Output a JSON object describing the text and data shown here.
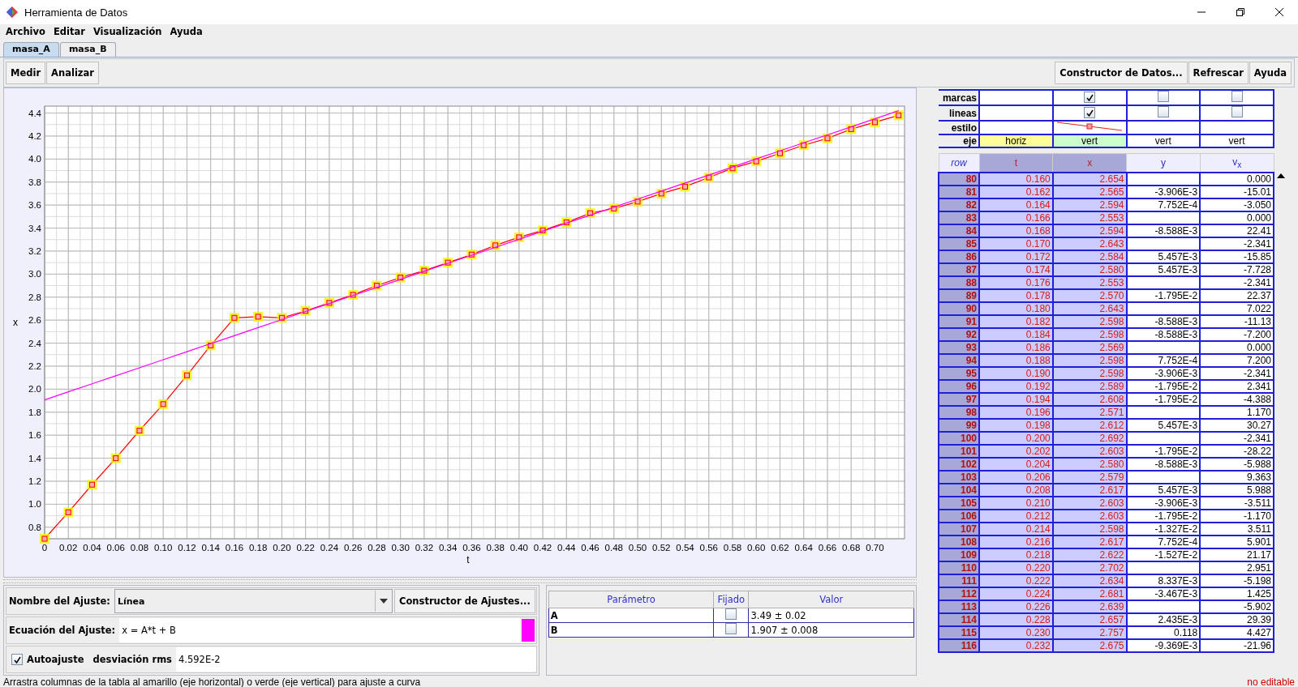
{
  "window": {
    "title": "Herramienta de Datos"
  },
  "menu": [
    "Archivo",
    "Editar",
    "Visualización",
    "Ayuda"
  ],
  "tabs": [
    {
      "label": "masa_A",
      "selected": true
    },
    {
      "label": "masa_B",
      "selected": false
    }
  ],
  "toolbar": {
    "left": [
      "Medir",
      "Analizar"
    ],
    "right": [
      "Constructor de Datos...",
      "Refrescar",
      "Ayuda"
    ]
  },
  "chart": {
    "chart_data": {
      "type": "line",
      "grid": true,
      "xlabel": "t",
      "ylabel": "x",
      "xlim": [
        0,
        0.725
      ],
      "ylim": [
        0.7,
        4.46
      ],
      "x": [
        0,
        0.02,
        0.04,
        0.06,
        0.08,
        0.1,
        0.12,
        0.14,
        0.16,
        0.18,
        0.2,
        0.22,
        0.24,
        0.26,
        0.28,
        0.3,
        0.32,
        0.34,
        0.36,
        0.38,
        0.4,
        0.42,
        0.44,
        0.46,
        0.48,
        0.5,
        0.52,
        0.54,
        0.56,
        0.58,
        0.6,
        0.62,
        0.64,
        0.66,
        0.68,
        0.7,
        0.72
      ],
      "series": [
        {
          "color": "#ff0000",
          "marker": "square",
          "values": [
            0.7,
            0.93,
            1.17,
            1.4,
            1.64,
            1.87,
            2.12,
            2.38,
            2.62,
            2.63,
            2.62,
            2.68,
            2.75,
            2.82,
            2.9,
            2.97,
            3.03,
            3.1,
            3.17,
            3.25,
            3.32,
            3.38,
            3.45,
            3.53,
            3.57,
            3.63,
            3.7,
            3.76,
            3.84,
            3.92,
            3.98,
            4.05,
            4.12,
            4.18,
            4.26,
            4.32,
            4.38
          ]
        },
        {
          "color": "#ff00ff",
          "values": [
            1.907,
            1.977,
            2.047,
            2.116,
            2.186,
            2.256,
            2.326,
            2.396,
            2.465,
            2.535,
            2.605,
            2.675,
            2.745,
            2.814,
            2.884,
            2.954,
            3.024,
            3.094,
            3.163,
            3.233,
            3.303,
            3.373,
            3.443,
            3.512,
            3.582,
            3.652,
            3.722,
            3.792,
            3.861,
            3.931,
            4.001,
            4.071,
            4.141,
            4.21,
            4.28,
            4.35,
            4.42
          ]
        }
      ],
      "xticks": [
        {
          "value": 0,
          "label": "0"
        },
        {
          "value": 0.02,
          "label": "0.02"
        },
        {
          "value": 0.04,
          "label": "0.04"
        },
        {
          "value": 0.06,
          "label": "0.06"
        },
        {
          "value": 0.08,
          "label": "0.08"
        },
        {
          "value": 0.1,
          "label": "0.10"
        },
        {
          "value": 0.12,
          "label": "0.12"
        },
        {
          "value": 0.14,
          "label": "0.14"
        },
        {
          "value": 0.16,
          "label": "0.16"
        },
        {
          "value": 0.18,
          "label": "0.18"
        },
        {
          "value": 0.2,
          "label": "0.20"
        },
        {
          "value": 0.22,
          "label": "0.22"
        },
        {
          "value": 0.24,
          "label": "0.24"
        },
        {
          "value": 0.26,
          "label": "0.26"
        },
        {
          "value": 0.28,
          "label": "0.28"
        },
        {
          "value": 0.3,
          "label": "0.30"
        },
        {
          "value": 0.32,
          "label": "0.32"
        },
        {
          "value": 0.34,
          "label": "0.34"
        },
        {
          "value": 0.36,
          "label": "0.36"
        },
        {
          "value": 0.38,
          "label": "0.38"
        },
        {
          "value": 0.4,
          "label": "0.40"
        },
        {
          "value": 0.42,
          "label": "0.42"
        },
        {
          "value": 0.44,
          "label": "0.44"
        },
        {
          "value": 0.46,
          "label": "0.46"
        },
        {
          "value": 0.48,
          "label": "0.48"
        },
        {
          "value": 0.5,
          "label": "0.50"
        },
        {
          "value": 0.52,
          "label": "0.52"
        },
        {
          "value": 0.54,
          "label": "0.54"
        },
        {
          "value": 0.56,
          "label": "0.56"
        },
        {
          "value": 0.58,
          "label": "0.58"
        },
        {
          "value": 0.6,
          "label": "0.60"
        },
        {
          "value": 0.62,
          "label": "0.62"
        },
        {
          "value": 0.64,
          "label": "0.64"
        },
        {
          "value": 0.66,
          "label": "0.66"
        },
        {
          "value": 0.68,
          "label": "0.68"
        },
        {
          "value": 0.7,
          "label": "0.70"
        }
      ],
      "yticks": [
        {
          "value": 0.8,
          "label": "0.8"
        },
        {
          "value": 1,
          "label": "1.0"
        },
        {
          "value": 1.2,
          "label": "1.2"
        },
        {
          "value": 1.4,
          "label": "1.4"
        },
        {
          "value": 1.6,
          "label": "1.6"
        },
        {
          "value": 1.8,
          "label": "1.8"
        },
        {
          "value": 2,
          "label": "2.0"
        },
        {
          "value": 2.2,
          "label": "2.2"
        },
        {
          "value": 2.4,
          "label": "2.4"
        },
        {
          "value": 2.6,
          "label": "2.6"
        },
        {
          "value": 2.8,
          "label": "2.8"
        },
        {
          "value": 3,
          "label": "3.0"
        },
        {
          "value": 3.2,
          "label": "3.2"
        },
        {
          "value": 3.4,
          "label": "3.4"
        },
        {
          "value": 3.6,
          "label": "3.6"
        },
        {
          "value": 3.8,
          "label": "3.8"
        },
        {
          "value": 4,
          "label": "4.0"
        },
        {
          "value": 4.2,
          "label": "4.2"
        },
        {
          "value": 4.4,
          "label": "4.4"
        }
      ]
    }
  },
  "fit": {
    "name_label": "Nombre del Ajuste:",
    "name_value": "Línea",
    "builder_button": "Constructor de Ajustes...",
    "equation_label": "Ecuación del Ajuste:",
    "equation": "x = A*t + B",
    "color": "#ff00ff",
    "autofit_label": "Autoajuste",
    "autofit_checked": true,
    "rms_label": "desviación rms",
    "rms_value": "4.592E-2"
  },
  "parameters": {
    "columns": [
      "Parámetro",
      "Fijado",
      "Valor"
    ],
    "rows": [
      {
        "name": "A",
        "fixed": false,
        "value": "3.49 ± 0.02"
      },
      {
        "name": "B",
        "fixed": false,
        "value": "1.907 ± 0.008"
      }
    ]
  },
  "data_table": {
    "property_rows": [
      {
        "label": "marcas",
        "cells": [
          {
            "kind": "blank"
          },
          {
            "kind": "checkbox",
            "checked": true
          },
          {
            "kind": "checkbox",
            "checked": false
          },
          {
            "kind": "checkbox",
            "checked": false
          }
        ]
      },
      {
        "label": "lineas",
        "cells": [
          {
            "kind": "blank"
          },
          {
            "kind": "checkbox",
            "checked": true
          },
          {
            "kind": "checkbox",
            "checked": false
          },
          {
            "kind": "checkbox",
            "checked": false
          }
        ]
      },
      {
        "label": "estilo",
        "cells": [
          {
            "kind": "blank"
          },
          {
            "kind": "style"
          },
          {
            "kind": "blank"
          },
          {
            "kind": "blank"
          }
        ]
      },
      {
        "label": "eje",
        "cells": [
          {
            "kind": "text",
            "text": "horiz",
            "color": "#ffff99"
          },
          {
            "kind": "text",
            "text": "vert",
            "color": "#ccffcc"
          },
          {
            "kind": "text",
            "text": "vert"
          },
          {
            "kind": "text",
            "text": "vert"
          }
        ]
      }
    ],
    "row_header": "row",
    "columns": [
      {
        "label": "t",
        "selected": true
      },
      {
        "label": "x",
        "selected": true
      },
      {
        "label": "y",
        "selected": false
      },
      {
        "label": "v$_{x}$",
        "selected": false
      }
    ],
    "rows": [
      {
        "row": "80",
        "cells": [
          "0.160",
          "2.654",
          null,
          "0.000"
        ]
      },
      {
        "row": "81",
        "cells": [
          "0.162",
          "2.565",
          "-3.906E-3",
          "-15.01"
        ]
      },
      {
        "row": "82",
        "cells": [
          "0.164",
          "2.594",
          "7.752E-4",
          "-3.050"
        ]
      },
      {
        "row": "83",
        "cells": [
          "0.166",
          "2.553",
          null,
          "0.000"
        ]
      },
      {
        "row": "84",
        "cells": [
          "0.168",
          "2.594",
          "-8.588E-3",
          "22.41"
        ]
      },
      {
        "row": "85",
        "cells": [
          "0.170",
          "2.643",
          null,
          "-2.341"
        ]
      },
      {
        "row": "86",
        "cells": [
          "0.172",
          "2.584",
          "5.457E-3",
          "-15.85"
        ]
      },
      {
        "row": "87",
        "cells": [
          "0.174",
          "2.580",
          "5.457E-3",
          "-7.728"
        ]
      },
      {
        "row": "88",
        "cells": [
          "0.176",
          "2.553",
          null,
          "-2.341"
        ]
      },
      {
        "row": "89",
        "cells": [
          "0.178",
          "2.570",
          "-1.795E-2",
          "22.37"
        ]
      },
      {
        "row": "90",
        "cells": [
          "0.180",
          "2.643",
          null,
          "7.022"
        ]
      },
      {
        "row": "91",
        "cells": [
          "0.182",
          "2.598",
          "-8.588E-3",
          "-11.13"
        ]
      },
      {
        "row": "92",
        "cells": [
          "0.184",
          "2.598",
          "-8.588E-3",
          "-7.200"
        ]
      },
      {
        "row": "93",
        "cells": [
          "0.186",
          "2.569",
          null,
          "0.000"
        ]
      },
      {
        "row": "94",
        "cells": [
          "0.188",
          "2.598",
          "7.752E-4",
          "7.200"
        ]
      },
      {
        "row": "95",
        "cells": [
          "0.190",
          "2.598",
          "-3.906E-3",
          "-2.341"
        ]
      },
      {
        "row": "96",
        "cells": [
          "0.192",
          "2.589",
          "-1.795E-2",
          "2.341"
        ]
      },
      {
        "row": "97",
        "cells": [
          "0.194",
          "2.608",
          "-1.795E-2",
          "-4.388"
        ]
      },
      {
        "row": "98",
        "cells": [
          "0.196",
          "2.571",
          null,
          "1.170"
        ]
      },
      {
        "row": "99",
        "cells": [
          "0.198",
          "2.612",
          "5.457E-3",
          "30.27"
        ]
      },
      {
        "row": "100",
        "cells": [
          "0.200",
          "2.692",
          null,
          "-2.341"
        ]
      },
      {
        "row": "101",
        "cells": [
          "0.202",
          "2.603",
          "-1.795E-2",
          "-28.22"
        ]
      },
      {
        "row": "102",
        "cells": [
          "0.204",
          "2.580",
          "-8.588E-3",
          "-5.988"
        ]
      },
      {
        "row": "103",
        "cells": [
          "0.206",
          "2.579",
          null,
          "9.363"
        ]
      },
      {
        "row": "104",
        "cells": [
          "0.208",
          "2.617",
          "5.457E-3",
          "5.988"
        ]
      },
      {
        "row": "105",
        "cells": [
          "0.210",
          "2.603",
          "-3.906E-3",
          "-3.511"
        ]
      },
      {
        "row": "106",
        "cells": [
          "0.212",
          "2.603",
          "-1.795E-2",
          "-1.170"
        ]
      },
      {
        "row": "107",
        "cells": [
          "0.214",
          "2.598",
          "-1.327E-2",
          "3.511"
        ]
      },
      {
        "row": "108",
        "cells": [
          "0.216",
          "2.617",
          "7.752E-4",
          "5.901"
        ]
      },
      {
        "row": "109",
        "cells": [
          "0.218",
          "2.622",
          "-1.527E-2",
          "21.17"
        ]
      },
      {
        "row": "110",
        "cells": [
          "0.220",
          "2.702",
          null,
          "2.951"
        ]
      },
      {
        "row": "111",
        "cells": [
          "0.222",
          "2.634",
          "8.337E-3",
          "-5.198"
        ]
      },
      {
        "row": "112",
        "cells": [
          "0.224",
          "2.681",
          "-3.467E-3",
          "1.425"
        ]
      },
      {
        "row": "113",
        "cells": [
          "0.226",
          "2.639",
          null,
          "-5.902"
        ]
      },
      {
        "row": "114",
        "cells": [
          "0.228",
          "2.657",
          "2.435E-3",
          "29.39"
        ]
      },
      {
        "row": "115",
        "cells": [
          "0.230",
          "2.757",
          "0.118",
          "4.427"
        ]
      },
      {
        "row": "116",
        "cells": [
          "0.232",
          "2.675",
          "-9.369E-3",
          "-21.96"
        ]
      }
    ]
  },
  "status_bar": {
    "hint": "Arrastra columnas de la tabla al amarillo (eje horizontal) o verde (eje vertical) para ajuste a curva",
    "mode": "no editable"
  }
}
